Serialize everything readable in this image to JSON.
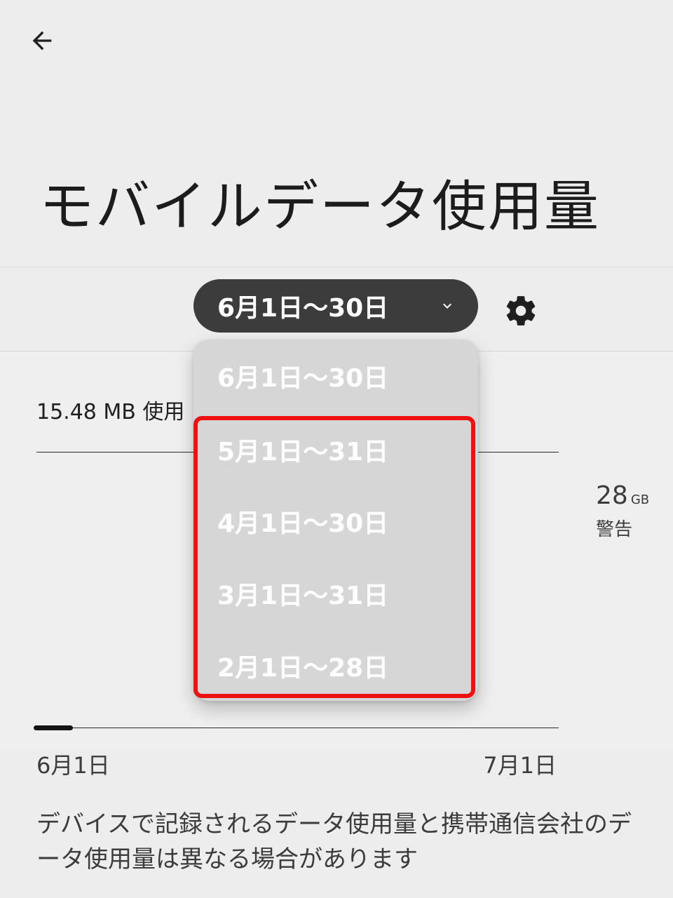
{
  "header": {
    "title": "モバイルデータ使用量"
  },
  "cycle_selector": {
    "selected_label": "6月1日〜30日"
  },
  "usage": {
    "used_label": "15.48 MB 使用",
    "usage_fraction_of_cycle": 0.07
  },
  "warning": {
    "value": "28",
    "unit": "GB",
    "label": "警告"
  },
  "chart_axis": {
    "start_date": "6月1日",
    "end_date": "7月1日"
  },
  "footer_note": "デバイスで記録されるデータ使用量と携帯通信会社のデータ使用量は異なる場合があります",
  "dropdown": {
    "items": [
      {
        "label": "6月1日〜30日"
      },
      {
        "label": "5月1日〜31日"
      },
      {
        "label": "4月1日〜30日"
      },
      {
        "label": "3月1日〜31日"
      },
      {
        "label": "2月1日〜28日"
      }
    ]
  },
  "colors": {
    "selector_bg": "#3c3c3c",
    "dropdown_bg": "#d6d6d6",
    "highlight": "#ee1111",
    "background": "#ededed"
  }
}
